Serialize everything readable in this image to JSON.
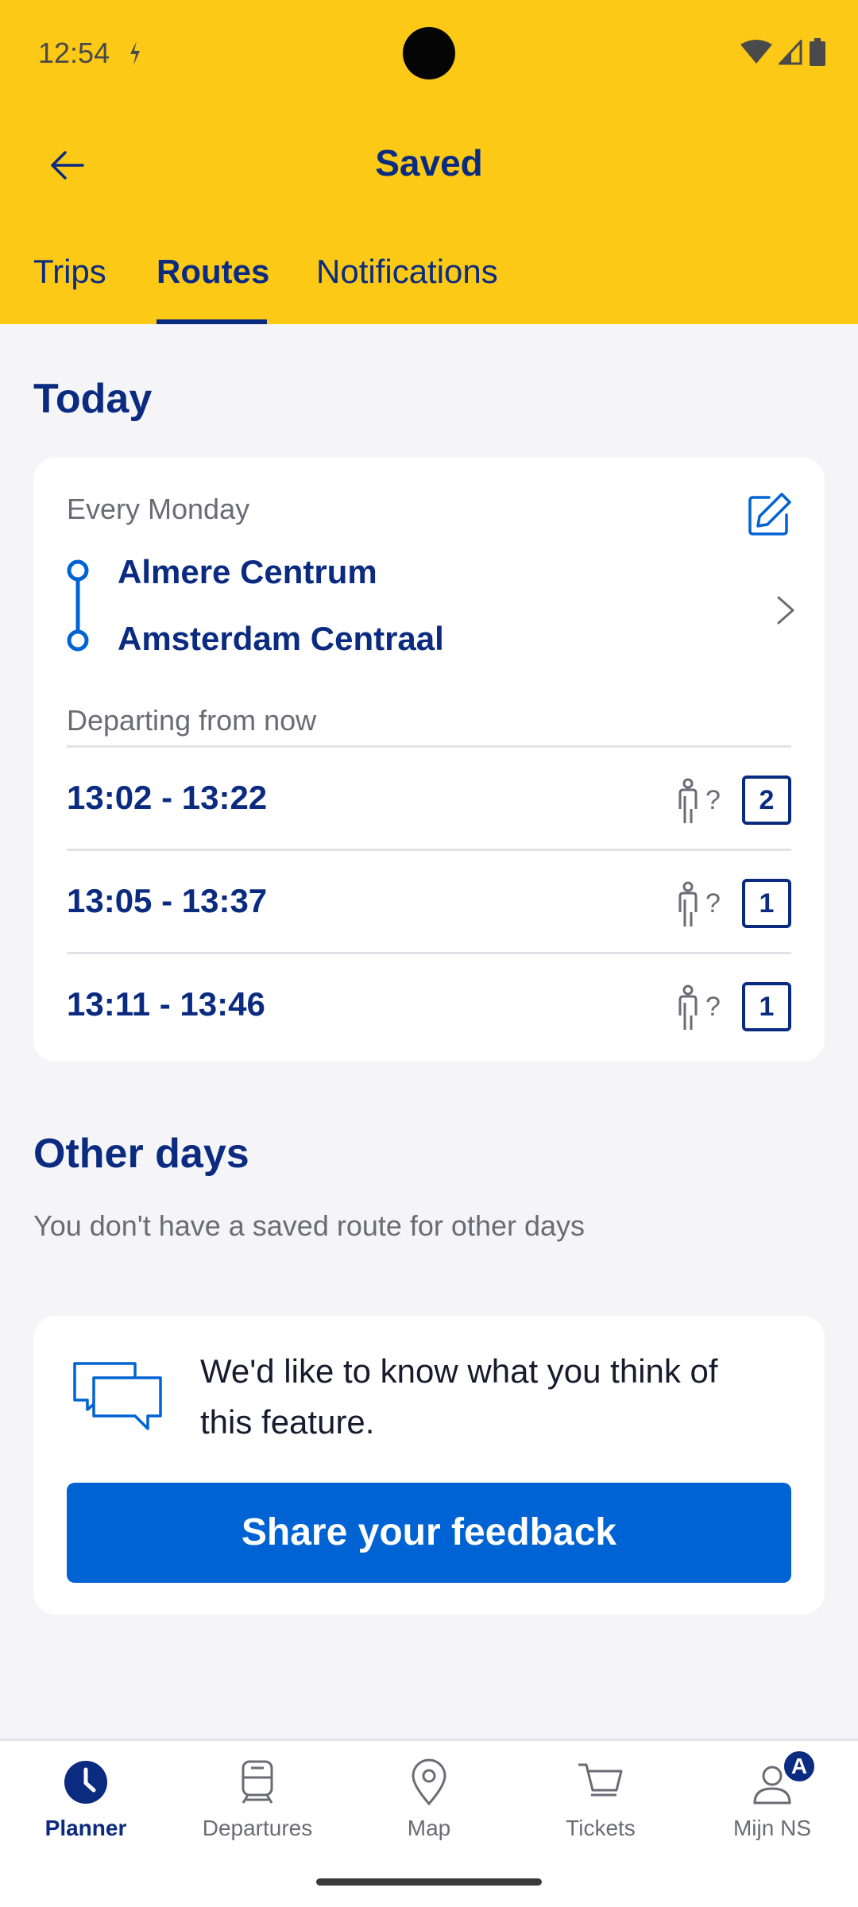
{
  "status_bar": {
    "time": "12:54"
  },
  "header": {
    "title": "Saved",
    "tabs": [
      {
        "label": "Trips",
        "active": false
      },
      {
        "label": "Routes",
        "active": true
      },
      {
        "label": "Notifications",
        "active": false
      }
    ]
  },
  "today": {
    "title": "Today",
    "card": {
      "recurrence": "Every Monday",
      "from": "Almere Centrum",
      "to": "Amsterdam Centraal",
      "departing_label": "Departing from now",
      "trips": [
        {
          "time": "13:02 - 13:22",
          "crowd": "?",
          "platform": "2"
        },
        {
          "time": "13:05 - 13:37",
          "crowd": "?",
          "platform": "1"
        },
        {
          "time": "13:11 - 13:46",
          "crowd": "?",
          "platform": "1"
        }
      ]
    }
  },
  "other_days": {
    "title": "Other days",
    "message": "You don't have a saved route for other days"
  },
  "feedback": {
    "text": "We'd like to know what you think of this feature.",
    "button_label": "Share your feedback"
  },
  "bottom_nav": {
    "items": [
      {
        "label": "Planner",
        "active": true
      },
      {
        "label": "Departures",
        "active": false
      },
      {
        "label": "Map",
        "active": false
      },
      {
        "label": "Tickets",
        "active": false
      },
      {
        "label": "Mijn NS",
        "active": false,
        "badge": "A"
      }
    ]
  },
  "colors": {
    "brand_yellow": "#fdc917",
    "brand_blue": "#0b2b80",
    "accent_blue": "#0063d3"
  }
}
